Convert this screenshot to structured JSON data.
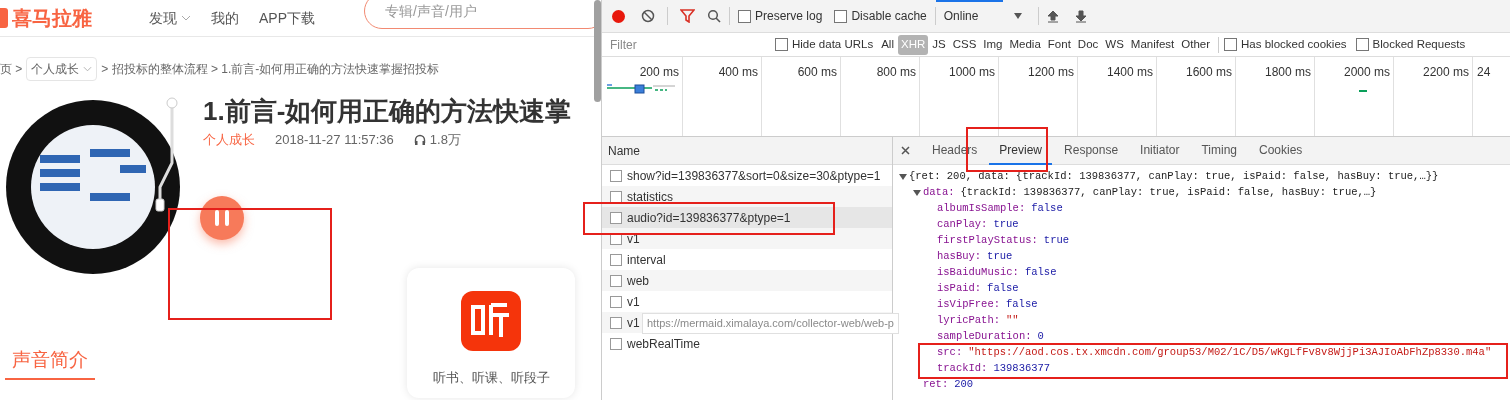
{
  "site": {
    "logo": "喜马拉雅",
    "nav": [
      {
        "label": "发现",
        "dropdown": true
      },
      {
        "label": "我的",
        "dropdown": false
      },
      {
        "label": "APP下载",
        "dropdown": false
      }
    ],
    "search": {
      "placeholder": "专辑/声音/用户"
    }
  },
  "breadcrumb": {
    "start": "页 >",
    "category": "个人成长",
    "path": "> 招投标的整体流程 > 1.前言-如何用正确的方法快速掌握招投标"
  },
  "track": {
    "title": "1.前言-如何用正确的方法快速掌",
    "category": "个人成长",
    "date": "2018-11-27 11:57:36",
    "plays": "1.8万",
    "playing": true
  },
  "app_card": {
    "caption": "听书、听课、听段子"
  },
  "intro_tab": {
    "label": "声音简介",
    "selected": true
  },
  "devtools": {
    "toolbar": {
      "recording": true,
      "filter_active": true,
      "preserve_log": {
        "label": "Preserve log",
        "checked": false
      },
      "disable_cache": {
        "label": "Disable cache",
        "checked": false
      },
      "throttle": "Online"
    },
    "filter_bar": {
      "placeholder": "Filter",
      "hide_data_urls": {
        "label": "Hide data URLs",
        "checked": false
      },
      "types": [
        {
          "label": "All",
          "selected": false
        },
        {
          "label": "XHR",
          "selected": true
        },
        {
          "label": "JS",
          "selected": false
        },
        {
          "label": "CSS",
          "selected": false
        },
        {
          "label": "Img",
          "selected": false
        },
        {
          "label": "Media",
          "selected": false
        },
        {
          "label": "Font",
          "selected": false
        },
        {
          "label": "Doc",
          "selected": false
        },
        {
          "label": "WS",
          "selected": false
        },
        {
          "label": "Manifest",
          "selected": false
        },
        {
          "label": "Other",
          "selected": false
        }
      ],
      "blocked_cookies": {
        "label": "Has blocked cookies",
        "checked": false
      },
      "blocked_requests": {
        "label": "Blocked Requests",
        "checked": false
      }
    },
    "timeline_ticks": [
      "200 ms",
      "400 ms",
      "600 ms",
      "800 ms",
      "1000 ms",
      "1200 ms",
      "1400 ms",
      "1600 ms",
      "1800 ms",
      "2000 ms",
      "2200 ms",
      "24"
    ],
    "requests_header": "Name",
    "requests": [
      {
        "name": "show?id=139836377&sort=0&size=30&ptype=1",
        "selected": false
      },
      {
        "name": "statistics",
        "selected": false
      },
      {
        "name": "audio?id=139836377&ptype=1",
        "selected": true
      },
      {
        "name": "v1",
        "selected": false
      },
      {
        "name": "interval",
        "selected": false
      },
      {
        "name": "web",
        "selected": false
      },
      {
        "name": "v1",
        "selected": false
      },
      {
        "name": "v1",
        "selected": false
      },
      {
        "name": "webRealTime",
        "selected": false
      }
    ],
    "tooltip": "https://mermaid.ximalaya.com/collector-web/web-p",
    "detail_tabs": [
      {
        "label": "Headers",
        "selected": false
      },
      {
        "label": "Preview",
        "selected": true
      },
      {
        "label": "Response",
        "selected": false
      },
      {
        "label": "Initiator",
        "selected": false
      },
      {
        "label": "Timing",
        "selected": false
      },
      {
        "label": "Cookies",
        "selected": false
      }
    ],
    "preview": [
      {
        "kind": "summary",
        "text": "{ret: 200, data: {trackId: 139836377, canPlay: true, isPaid: false, hasBuy: true,…}}",
        "expanded": true,
        "children": [
          {
            "kind": "summary",
            "key": "data:",
            "text": "{trackId: 139836377, canPlay: true, isPaid: false, hasBuy: true,…}",
            "expanded": true,
            "children": [
              {
                "kind": "literal",
                "key": "albumIsSample:",
                "value": "false"
              },
              {
                "kind": "literal",
                "key": "canPlay:",
                "value": "true"
              },
              {
                "kind": "literal",
                "key": "firstPlayStatus:",
                "value": "true"
              },
              {
                "kind": "literal",
                "key": "hasBuy:",
                "value": "true"
              },
              {
                "kind": "literal",
                "key": "isBaiduMusic:",
                "value": "false"
              },
              {
                "kind": "literal",
                "key": "isPaid:",
                "value": "false"
              },
              {
                "kind": "literal",
                "key": "isVipFree:",
                "value": "false"
              },
              {
                "kind": "string",
                "key": "lyricPath:",
                "value": "\"\""
              },
              {
                "kind": "literal",
                "key": "sampleDuration:",
                "value": "0"
              },
              {
                "kind": "string",
                "key": "src:",
                "value": "\"https://aod.cos.tx.xmcdn.com/group53/M02/1C/D5/wKgLfFv8v8WjjPi3AJIoAbFhZp8330.m4a\""
              },
              {
                "kind": "literal",
                "key": "trackId:",
                "value": "139836377"
              }
            ]
          },
          {
            "kind": "literal",
            "key": "ret:",
            "value": "200"
          }
        ]
      }
    ]
  }
}
